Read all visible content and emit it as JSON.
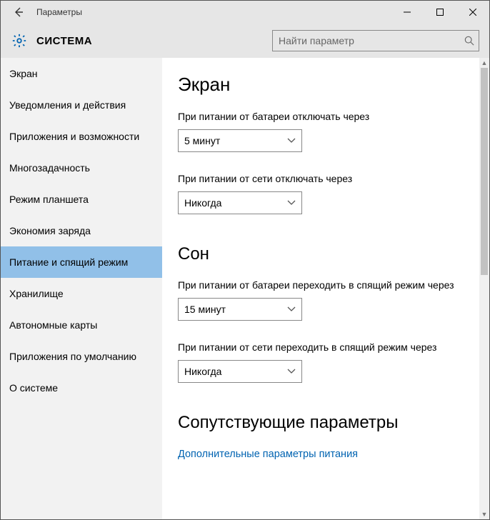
{
  "window": {
    "title": "Параметры"
  },
  "header": {
    "section": "СИСТЕМА",
    "search_placeholder": "Найти параметр"
  },
  "sidebar": {
    "items": [
      {
        "label": "Экран",
        "selected": false
      },
      {
        "label": "Уведомления и действия",
        "selected": false
      },
      {
        "label": "Приложения и возможности",
        "selected": false
      },
      {
        "label": "Многозадачность",
        "selected": false
      },
      {
        "label": "Режим планшета",
        "selected": false
      },
      {
        "label": "Экономия заряда",
        "selected": false
      },
      {
        "label": "Питание и спящий режим",
        "selected": true
      },
      {
        "label": "Хранилище",
        "selected": false
      },
      {
        "label": "Автономные карты",
        "selected": false
      },
      {
        "label": "Приложения по умолчанию",
        "selected": false
      },
      {
        "label": "О системе",
        "selected": false
      }
    ]
  },
  "content": {
    "screen": {
      "heading": "Экран",
      "battery_label": "При питании от батареи отключать через",
      "battery_value": "5 минут",
      "plugged_label": "При питании от сети отключать через",
      "plugged_value": "Никогда"
    },
    "sleep": {
      "heading": "Сон",
      "battery_label": "При питании от батареи переходить в спящий режим через",
      "battery_value": "15 минут",
      "plugged_label": "При питании от сети переходить в спящий режим через",
      "plugged_value": "Никогда"
    },
    "related": {
      "heading": "Сопутствующие параметры",
      "link": "Дополнительные параметры питания"
    }
  }
}
